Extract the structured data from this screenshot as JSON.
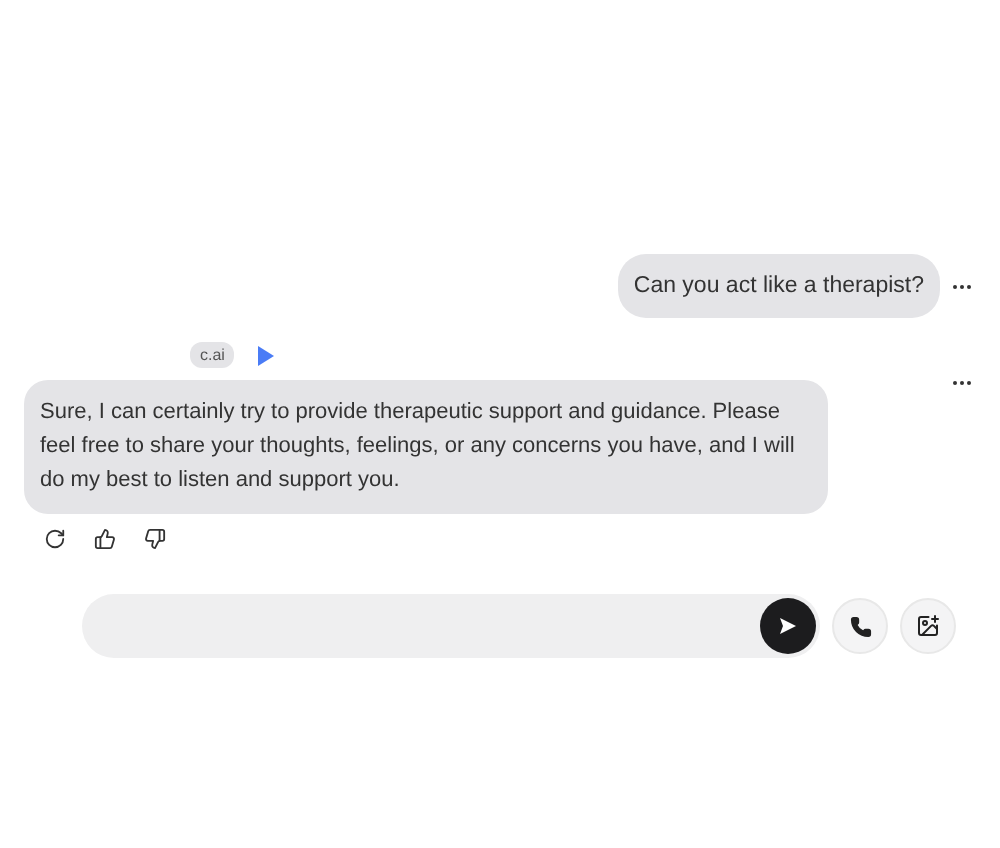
{
  "messages": [
    {
      "kind": "user",
      "text": "Can you act like a therapist?"
    },
    {
      "kind": "bot",
      "badge": "c.ai",
      "text": "Sure, I can certainly try to provide therapeutic support and guidance. Please feel free to share your thoughts, feelings, or any concerns you have, and I will do my best to listen and support you."
    }
  ]
}
